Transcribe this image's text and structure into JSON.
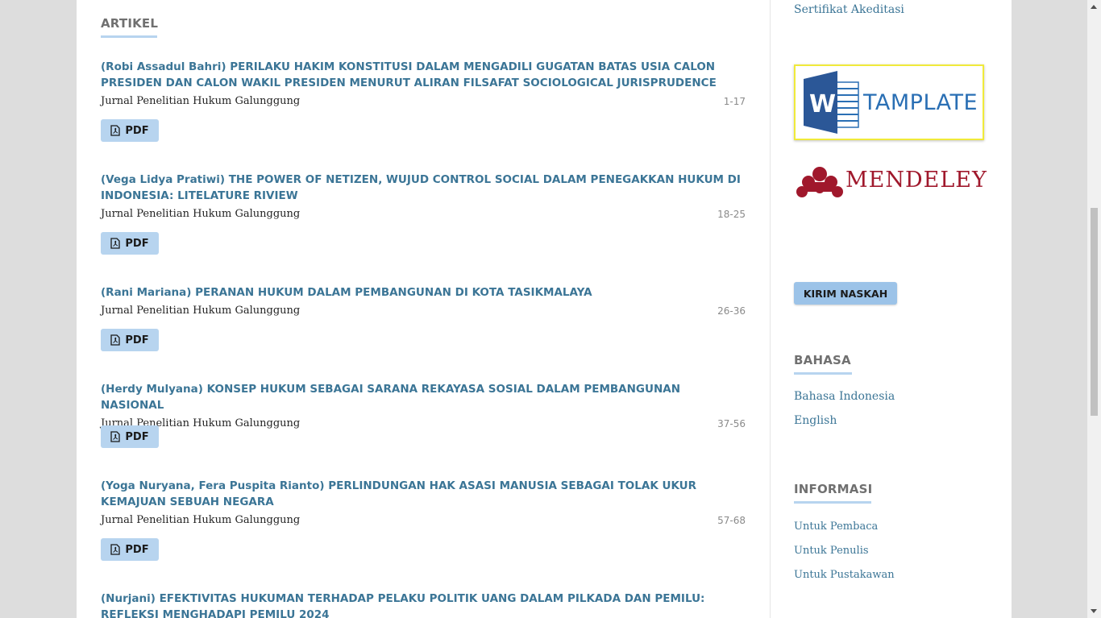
{
  "main": {
    "section_title": "ARTIKEL",
    "articles": [
      {
        "title": "(Robi Assadul Bahri) PERILAKU HAKIM KONSTITUSI DALAM MENGADILI GUGATAN BATAS USIA CALON PRESIDEN DAN CALON WAKIL PRESIDEN MENURUT ALIRAN FILSAFAT SOCIOLOGICAL JURISPRUDENCE",
        "journal": "Jurnal Penelitian Hukum Galunggung",
        "pages": "1-17",
        "button": "PDF"
      },
      {
        "title": "(Vega Lidya Pratiwi) THE POWER OF NETIZEN, WUJUD CONTROL SOCIAL DALAM PENEGAKKAN HUKUM DI INDONESIA: LITELATURE RIVIEW",
        "journal": "Jurnal Penelitian Hukum Galunggung",
        "pages": "18-25",
        "button": "PDF"
      },
      {
        "title": "(Rani Mariana) PERANAN HUKUM DALAM PEMBANGUNAN DI KOTA TASIKMALAYA",
        "journal": "Jurnal Penelitian Hukum Galunggung",
        "pages": "26-36",
        "button": "PDF"
      },
      {
        "title": "(Herdy Mulyana) KONSEP HUKUM SEBAGAI SARANA REKAYASA SOSIAL DALAM PEMBANGUNAN NASIONAL",
        "journal": "Jurnal Penelitian Hukum Galunggung",
        "pages": "37-56",
        "button": "PDF"
      },
      {
        "title": "(Yoga Nuryana, Fera Puspita Rianto) PERLINDUNGAN HAK ASASI MANUSIA SEBAGAI TOLAK UKUR KEMAJUAN SEBUAH NEGARA",
        "journal": "Jurnal Penelitian Hukum Galunggung",
        "pages": "57-68",
        "button": "PDF"
      },
      {
        "title": "(Nurjani) EFEKTIVITAS HUKUMAN TERHADAP PELAKU POLITIK UANG DALAM PILKADA DAN PEMILU: REFLEKSI MENGHADAPI PEMILU 2024"
      }
    ]
  },
  "sidebar": {
    "cert_link": "Sertifikat Akeditasi",
    "template_banner": "TAMPLATE",
    "mendeley_banner": "MENDELEY",
    "kirim_button": "KIRIM NASKAH",
    "bahasa_title": "BAHASA",
    "languages": [
      "Bahasa Indonesia",
      "English"
    ],
    "informasi_title": "INFORMASI",
    "info_links": [
      "Untuk Pembaca",
      "Untuk Penulis",
      "Untuk Pustakawan"
    ]
  },
  "colors": {
    "link": "#3b7596",
    "button_bg": "#b7d4ef",
    "underline": "#b7d4ef",
    "mendeley_red": "#a0182c",
    "word_blue": "#2a6fb4",
    "banner_border": "#f0ea3a"
  }
}
